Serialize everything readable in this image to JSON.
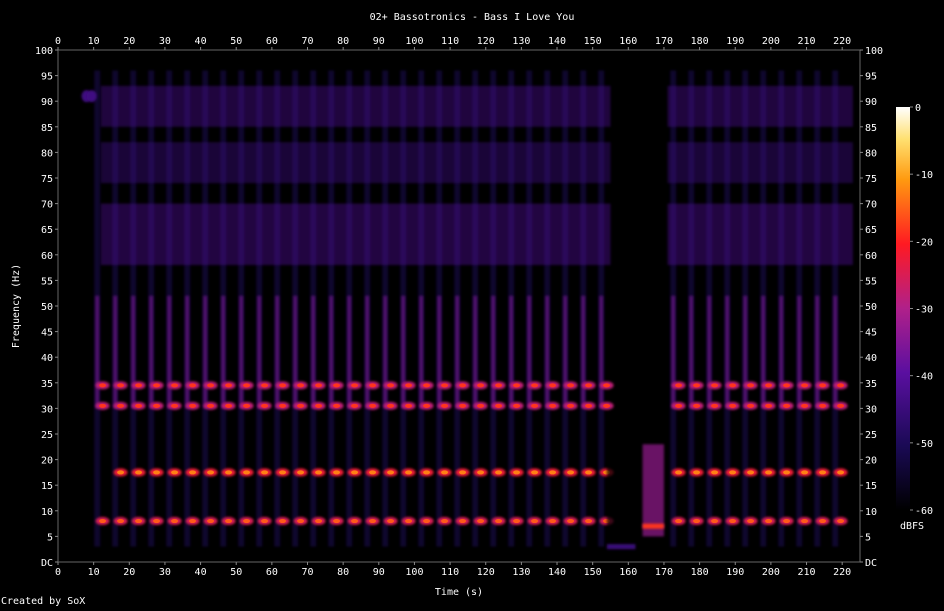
{
  "chart_data": {
    "type": "heatmap",
    "title": "02+ Bassotronics - Bass I Love You",
    "xlabel": "Time (s)",
    "ylabel": "Frequency (Hz)",
    "xlim": [
      0,
      225
    ],
    "ylim": [
      0,
      100
    ],
    "x_ticks": [
      0,
      10,
      20,
      30,
      40,
      50,
      60,
      70,
      80,
      90,
      100,
      110,
      120,
      130,
      140,
      150,
      160,
      170,
      180,
      190,
      200,
      210,
      220
    ],
    "y_ticks": [
      "DC",
      "5",
      "10",
      "15",
      "20",
      "25",
      "30",
      "35",
      "40",
      "45",
      "50",
      "55",
      "60",
      "65",
      "70",
      "75",
      "80",
      "85",
      "90",
      "95",
      "100"
    ],
    "colorbar": {
      "label": "dBFS",
      "ticks": [
        "0",
        "-10",
        "-20",
        "-30",
        "-40",
        "-50",
        "-60"
      ],
      "range": [
        -60,
        0
      ]
    },
    "grid": false,
    "beat_period_s": 5.05,
    "beats_start_s": 11,
    "silent_gap_s": [
      155,
      170
    ],
    "features": [
      {
        "kind": "beat_harmonic",
        "freq_hz": 8,
        "level_dbfs": -25,
        "t_start": 13,
        "t_end": 223
      },
      {
        "kind": "beat_harmonic",
        "freq_hz": 17.5,
        "level_dbfs": -22,
        "t_start": 17,
        "t_end": 222
      },
      {
        "kind": "beat_harmonic",
        "freq_hz": 30.5,
        "level_dbfs": -28,
        "t_start": 11,
        "t_end": 222
      },
      {
        "kind": "beat_harmonic",
        "freq_hz": 34.5,
        "level_dbfs": -28,
        "t_start": 13,
        "t_end": 222
      },
      {
        "kind": "mid_band",
        "freq_range_hz": [
          58,
          70
        ],
        "level_dbfs": -42
      },
      {
        "kind": "high_band",
        "freq_range_hz": [
          74,
          82
        ],
        "level_dbfs": -45
      },
      {
        "kind": "high_band",
        "freq_range_hz": [
          85,
          93
        ],
        "level_dbfs": -43
      },
      {
        "kind": "tone",
        "freq_hz": 7,
        "level_dbfs": -18,
        "t_start": 164,
        "t_end": 170
      },
      {
        "kind": "tone",
        "freq_hz": 3,
        "level_dbfs": -45,
        "t_start": 154,
        "t_end": 162
      }
    ]
  },
  "footer": {
    "credit": "Created by SoX"
  }
}
